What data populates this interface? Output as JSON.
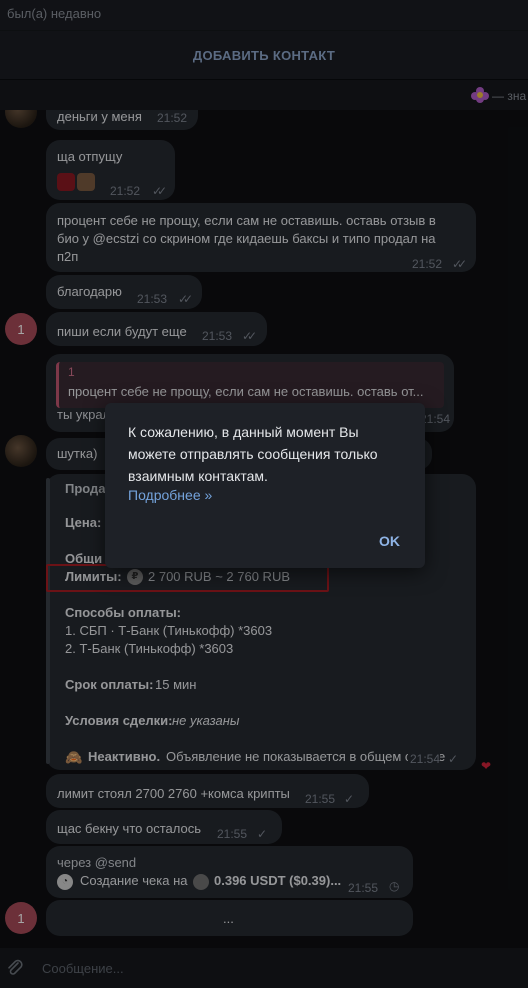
{
  "header": {
    "status": "был(а) недавно"
  },
  "add_contact": {
    "label": "ДОБАВИТЬ КОНТАКТ"
  },
  "pinned": {
    "text": "— зна"
  },
  "messages": {
    "m1": {
      "text": "деньги у меня",
      "time": "21:52"
    },
    "m2": {
      "text": "ща отпущу",
      "time": "21:52"
    },
    "m3": {
      "line1": "процент себе не прощу, если сам не оставишь. оставь отзыв  в",
      "line2": "био у @ecstzi со скрином где кидаешь баксы и типо продал на",
      "line3": "п2п",
      "time": "21:52"
    },
    "m4": {
      "text": "благодарю",
      "time": "21:53"
    },
    "m5": {
      "text": "пиши если будут еще",
      "time": "21:53"
    },
    "m6": {
      "quote_author": "1",
      "quote_text": "процент себе не прощу, если сам не оставишь. оставь от...",
      "text": "ты украл",
      "time": "21:54"
    },
    "m7": {
      "text": "шутка)"
    },
    "m8": {
      "title": "Прода",
      "price_label": "Цена:",
      "total_label": "Общи",
      "limits_label": "Лимиты:",
      "limits_value": "2 700 RUB ~ 2 760 RUB",
      "payment_label": "Способы оплаты:",
      "payment1": "1. СБП · Т-Банк (Тинькофф) *3603",
      "payment2": "2. Т-Банк (Тинькофф) *3603",
      "term_label": "Срок оплаты:",
      "term_value": "15 мин",
      "conditions_label": "Условия сделки:",
      "conditions_value": "не указаны",
      "inactive_bold": "Неактивно.",
      "inactive_text": "Объявление не показывается в общем списке",
      "time": "21:54"
    },
    "m9": {
      "text": "лимит стоял 2700 2760 +комса крипты",
      "time": "21:55"
    },
    "m10": {
      "text": "щас бекну что осталось",
      "time": "21:55"
    },
    "m11": {
      "title": "через @send",
      "text": "Создание чека на",
      "amount": "0.396 USDT ($0.39)...",
      "time": "21:55"
    },
    "m12": {
      "text": "..."
    }
  },
  "avatars": {
    "pink_letter": "1"
  },
  "modal": {
    "line1": "К сожалению, в данный момент Вы",
    "line2": "можете отправлять сообщения только",
    "line3": "взаимным контактам.",
    "more": "Подробнее »",
    "ok": "OK"
  },
  "composer": {
    "placeholder": "Сообщение..."
  },
  "colors": {
    "accent": "#74a3dc",
    "highlight_box": "#a51c23",
    "bubble": "#262a31"
  }
}
